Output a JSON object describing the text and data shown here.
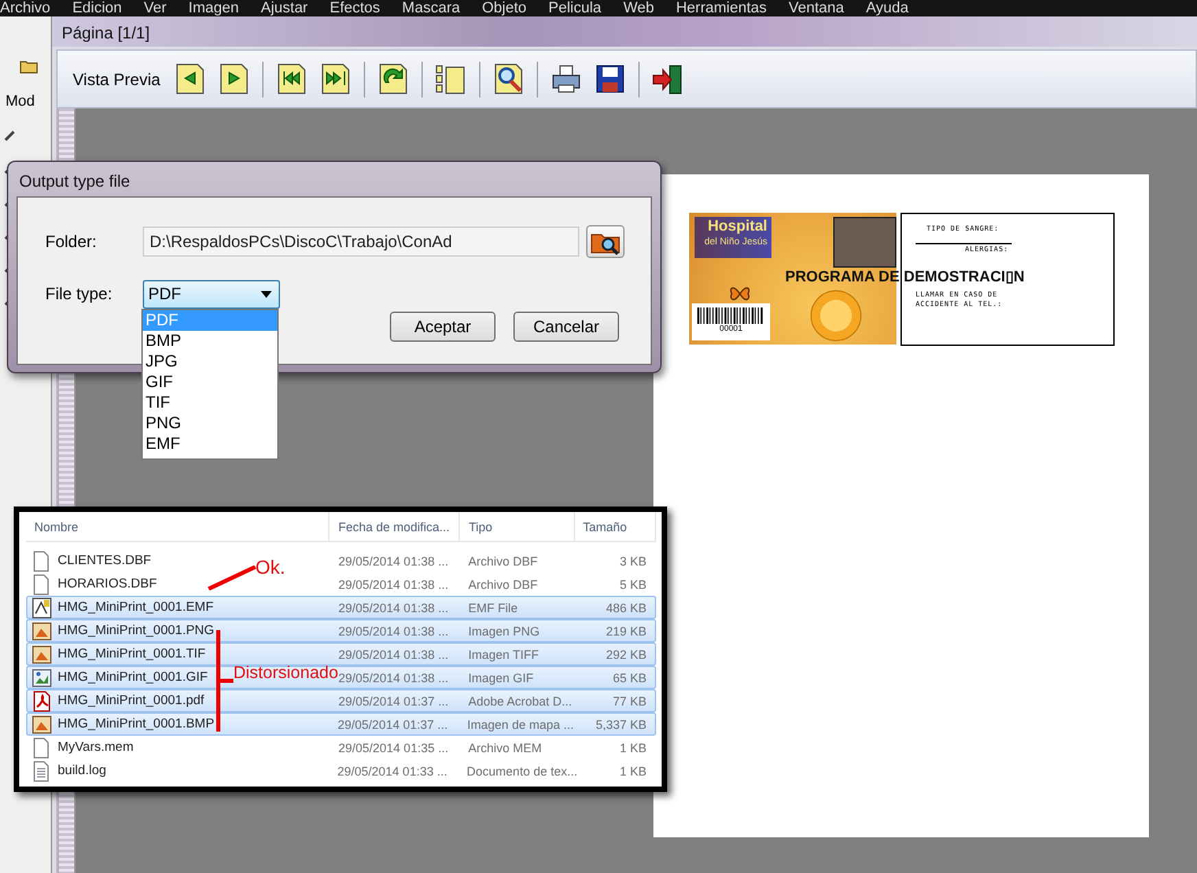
{
  "menu_bar": {
    "items": [
      "Archivo",
      "Edicion",
      "Ver",
      "Imagen",
      "Ajustar",
      "Efectos",
      "Mascara",
      "Objeto",
      "Pelicula",
      "Web",
      "Herramientas",
      "Ventana",
      "Ayuda"
    ]
  },
  "side_toolbar": {
    "label": "Mod"
  },
  "preview_window": {
    "title": "Página [1/1]",
    "toolbar": {
      "label": "Vista Previa",
      "buttons": [
        {
          "kind": "previous"
        },
        {
          "kind": "next"
        },
        {
          "kind": "first"
        },
        {
          "kind": "last"
        },
        {
          "kind": "rotate"
        },
        {
          "kind": "thumbnails"
        },
        {
          "kind": "zoom"
        },
        {
          "kind": "print"
        },
        {
          "kind": "save"
        },
        {
          "kind": "exit"
        }
      ]
    }
  },
  "page": {
    "card_front": {
      "logo_title": "Hospital",
      "logo_subtitle": "del Niño Jesús",
      "barcode_number": "00001"
    },
    "watermark": "PROGRAMA DE DEMOSTRACI▯N",
    "card_back": {
      "lines": [
        "TIPO DE SANGRE:",
        "ALERGIAS:",
        "LLAMAR EN CASO DE",
        "ACCIDENTE AL TEL.:"
      ]
    }
  },
  "dialog": {
    "title": "Output type file",
    "folder_label": "Folder:",
    "folder_value": "D:\\RespaldosPCs\\DiscoC\\Trabajo\\ConAd",
    "file_type_label": "File type:",
    "file_type_value": "PDF",
    "options": [
      {
        "label": "PDF",
        "selected": true
      },
      {
        "label": "BMP",
        "selected": false
      },
      {
        "label": "JPG",
        "selected": false
      },
      {
        "label": "GIF",
        "selected": false
      },
      {
        "label": "TIF",
        "selected": false
      },
      {
        "label": "PNG",
        "selected": false
      },
      {
        "label": "EMF",
        "selected": false
      }
    ],
    "buttons": [
      "Aceptar",
      "Cancelar"
    ]
  },
  "file_list": {
    "columns": [
      "Nombre",
      "Fecha de modifica...",
      "Tipo",
      "Tamaño"
    ],
    "rows": [
      {
        "kind": "document",
        "name": "CLIENTES.DBF",
        "date": "29/05/2014 01:38 ...",
        "type": "Archivo DBF",
        "size": "3 KB",
        "selected": false
      },
      {
        "kind": "document",
        "name": "HORARIOS.DBF",
        "date": "29/05/2014 01:38 ...",
        "type": "Archivo DBF",
        "size": "5 KB",
        "selected": false
      },
      {
        "kind": "vector",
        "name": "HMG_MiniPrint_0001.EMF",
        "date": "29/05/2014 01:38 ...",
        "type": "EMF File",
        "size": "486 KB",
        "selected": true
      },
      {
        "kind": "image",
        "name": "HMG_MiniPrint_0001.PNG",
        "date": "29/05/2014 01:38 ...",
        "type": "Imagen PNG",
        "size": "219 KB",
        "selected": true
      },
      {
        "kind": "image",
        "name": "HMG_MiniPrint_0001.TIF",
        "date": "29/05/2014 01:38 ...",
        "type": "Imagen TIFF",
        "size": "292 KB",
        "selected": true
      },
      {
        "kind": "picture",
        "name": "HMG_MiniPrint_0001.GIF",
        "date": "29/05/2014 01:38 ...",
        "type": "Imagen GIF",
        "size": "65 KB",
        "selected": true
      },
      {
        "kind": "pdf",
        "name": "HMG_MiniPrint_0001.pdf",
        "date": "29/05/2014 01:37 ...",
        "type": "Adobe Acrobat D...",
        "size": "77 KB",
        "selected": true
      },
      {
        "kind": "image",
        "name": "HMG_MiniPrint_0001.BMP",
        "date": "29/05/2014 01:37 ...",
        "type": "Imagen de mapa ...",
        "size": "5,337 KB",
        "selected": true
      },
      {
        "kind": "document",
        "name": "MyVars.mem",
        "date": "29/05/2014 01:35 ...",
        "type": "Archivo MEM",
        "size": "1 KB",
        "selected": false
      },
      {
        "kind": "text",
        "name": "build.log",
        "date": "29/05/2014 01:33 ...",
        "type": "Documento de tex...",
        "size": "1 KB",
        "selected": false
      }
    ]
  },
  "annotations": [
    {
      "kind": "pointer",
      "text": "Ok."
    },
    {
      "kind": "bracket",
      "text": "Distorsionado"
    }
  ]
}
